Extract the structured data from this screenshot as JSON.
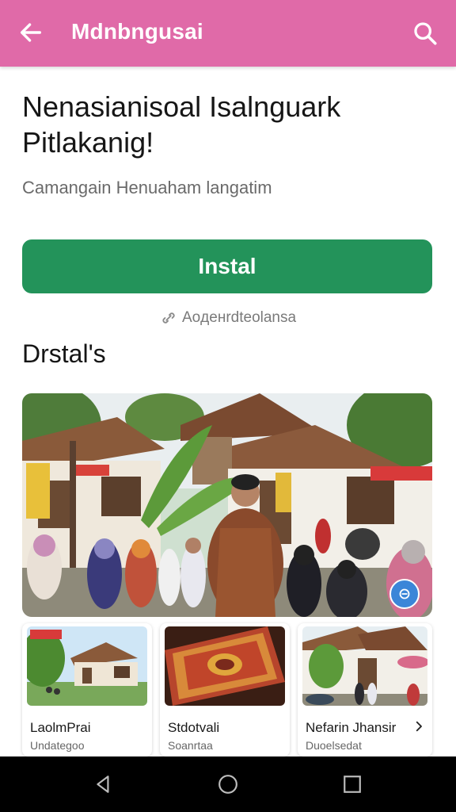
{
  "appbar": {
    "title": "Mdnbngusai",
    "back_icon": "arrow-left-icon",
    "search_icon": "search-icon",
    "color": "#e06aa8"
  },
  "main": {
    "heading": "Nenasianisoal Isalnguark Pitlakanig!",
    "subheading": "Camangain Henuaham langatim",
    "install_label": "Instal",
    "install_color": "#23935a",
    "notice_text": "Aoденrdteolansa",
    "notice_icon": "link-icon",
    "section_title": "Drstal's"
  },
  "cards": [
    {
      "title": "LaolmPrai",
      "subtitle": "Undategoo"
    },
    {
      "title": "Stdotvali",
      "subtitle": "Soanrtaa"
    },
    {
      "title": "Nefarin Jhansir",
      "subtitle": "Duoelsedat"
    }
  ],
  "navbar": {
    "back_icon": "nav-back-icon",
    "home_icon": "nav-home-icon",
    "recents_icon": "nav-recents-icon"
  }
}
